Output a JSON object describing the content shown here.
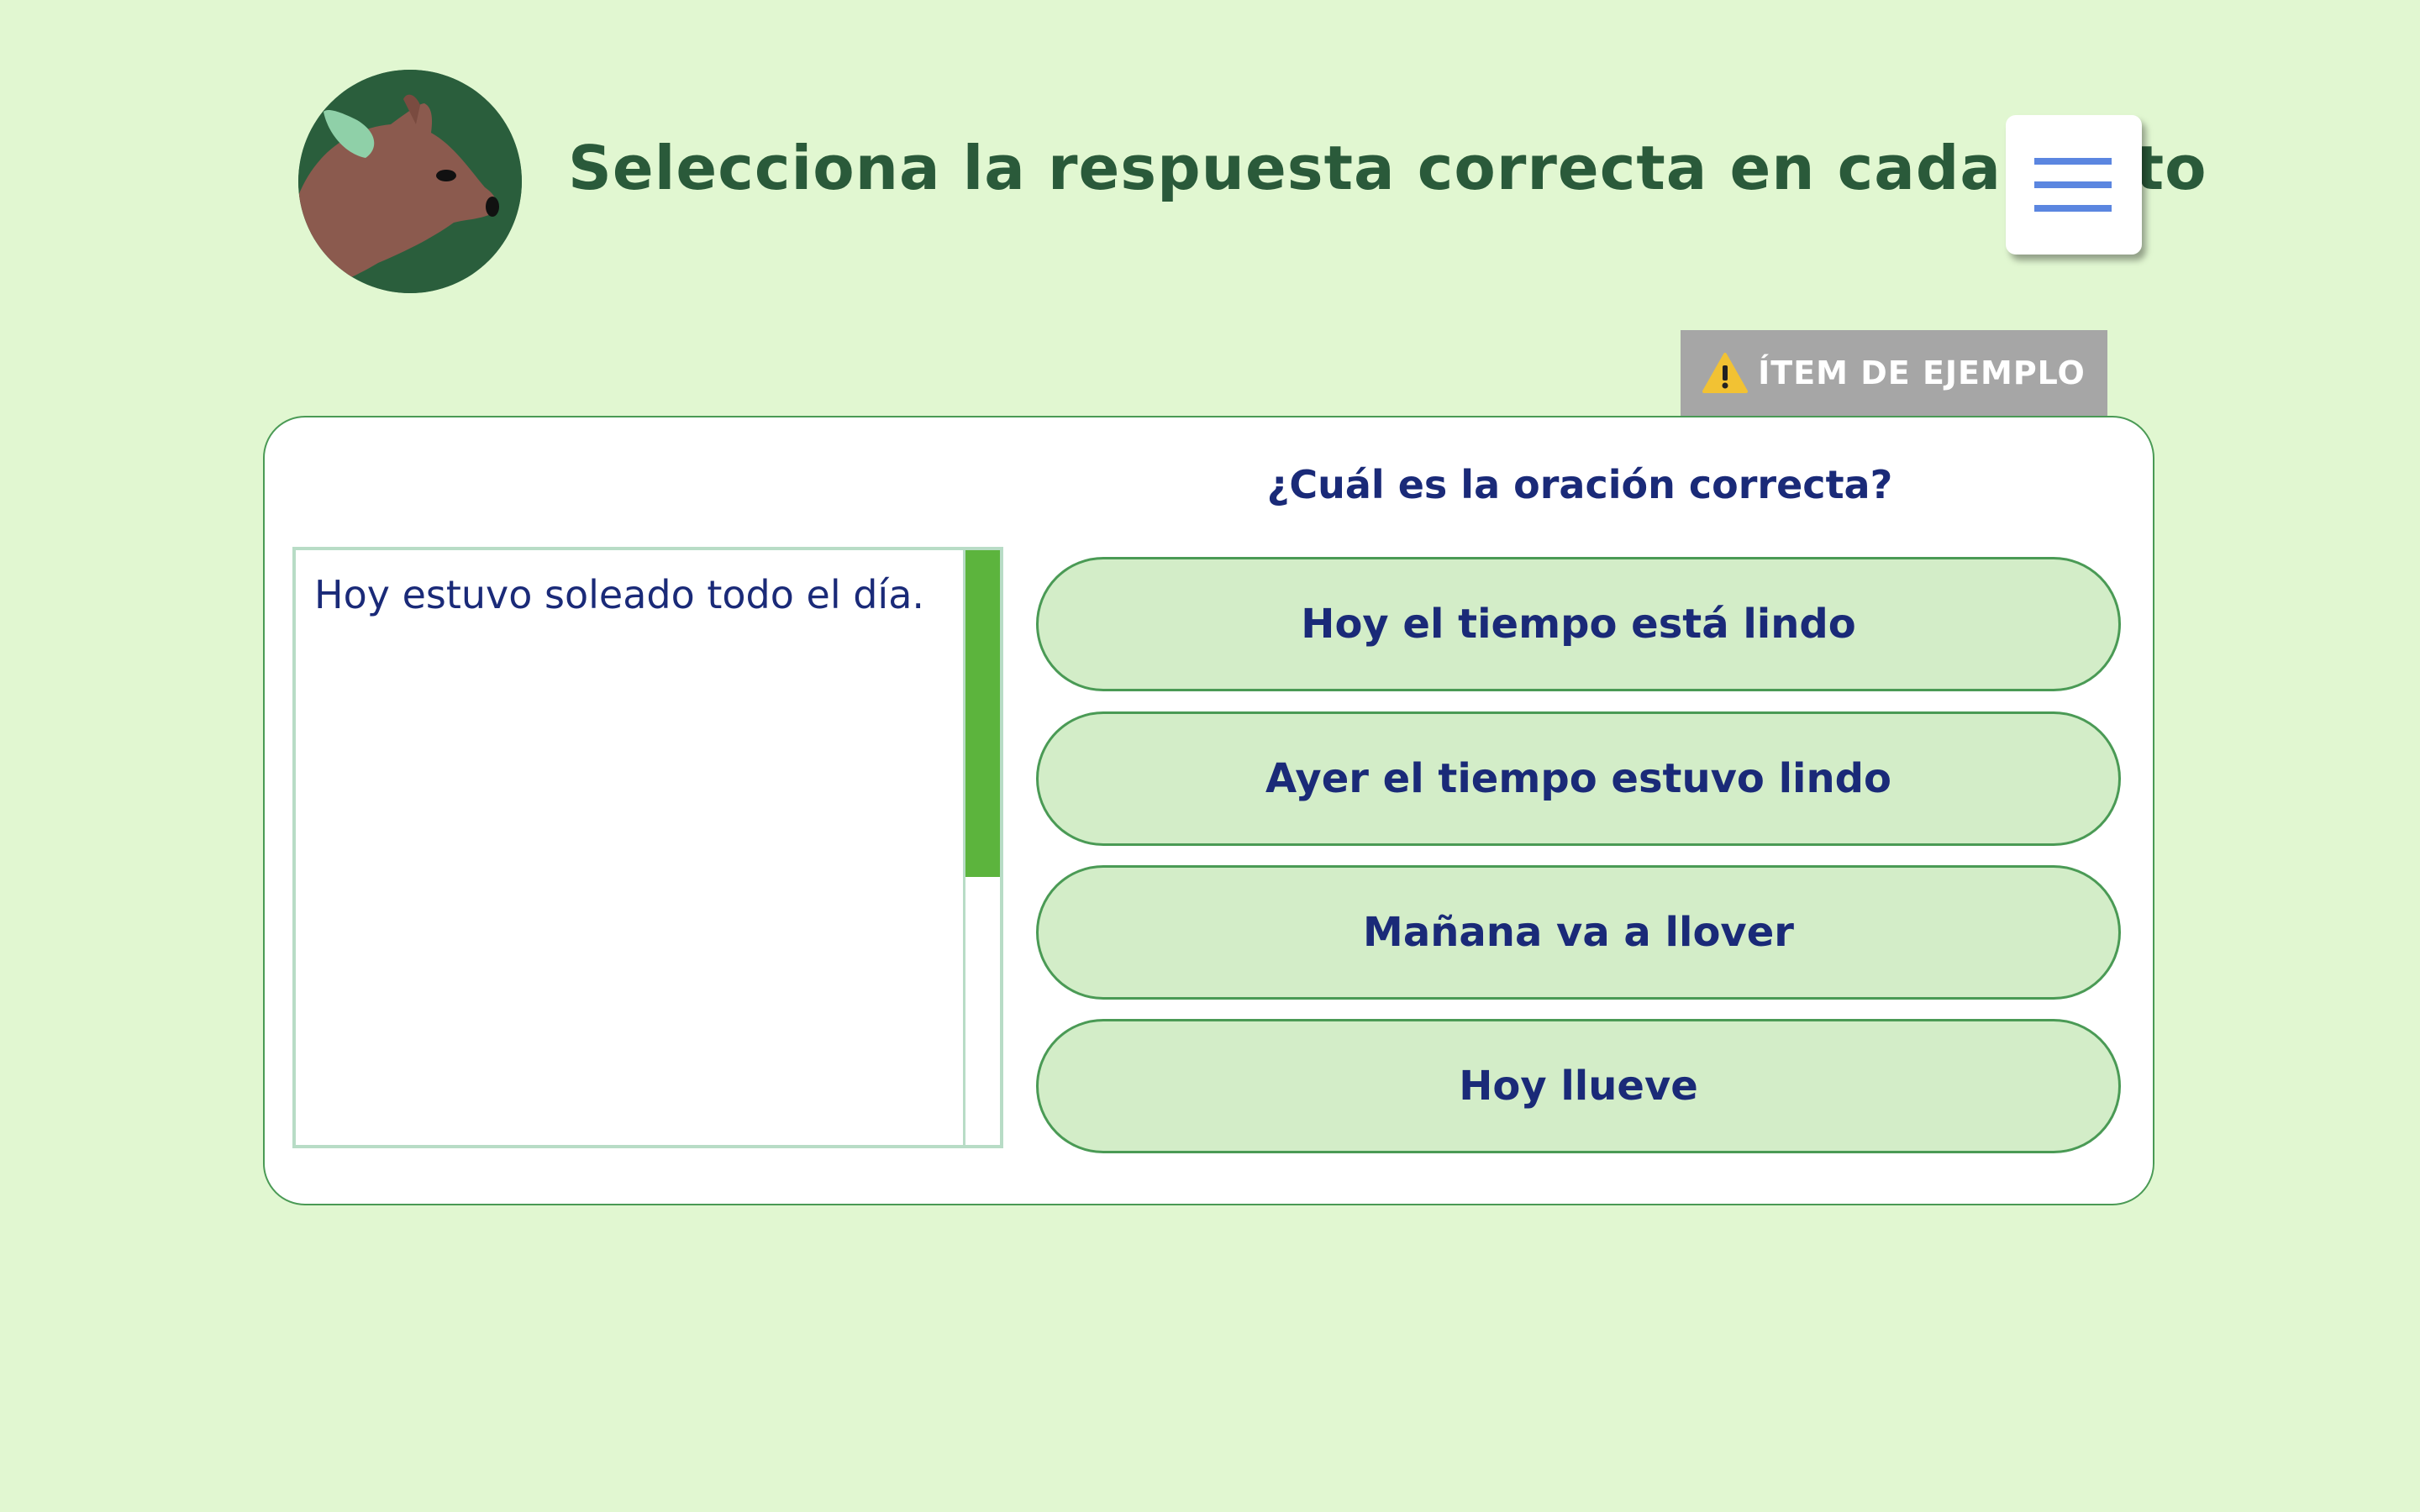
{
  "header": {
    "title": "Selecciona la respuesta correcta en cada texto",
    "avatar_icon": "deer-icon",
    "menu_icon": "hamburger-menu-icon"
  },
  "badge": {
    "icon": "warning-icon",
    "label": "ÍTEM DE EJEMPLO"
  },
  "passage": {
    "text": "Hoy estuvo soleado todo el día.",
    "scroll_fraction_visible": 0.55
  },
  "question": {
    "prompt": "¿Cuál es la oración correcta?",
    "options": [
      "Hoy el tiempo está lindo",
      "Ayer el tiempo estuvo lindo",
      "Mañana va a llover",
      "Hoy llueve"
    ]
  },
  "colors": {
    "background": "#e1f7d1",
    "title": "#2a5a3a",
    "text": "#1a2a78",
    "option_fill": "#d3edc8",
    "option_border": "#4a9a55",
    "scroll_thumb": "#5cb43d",
    "menu_bars": "#5b86e0",
    "badge": "#a6a6a6"
  }
}
